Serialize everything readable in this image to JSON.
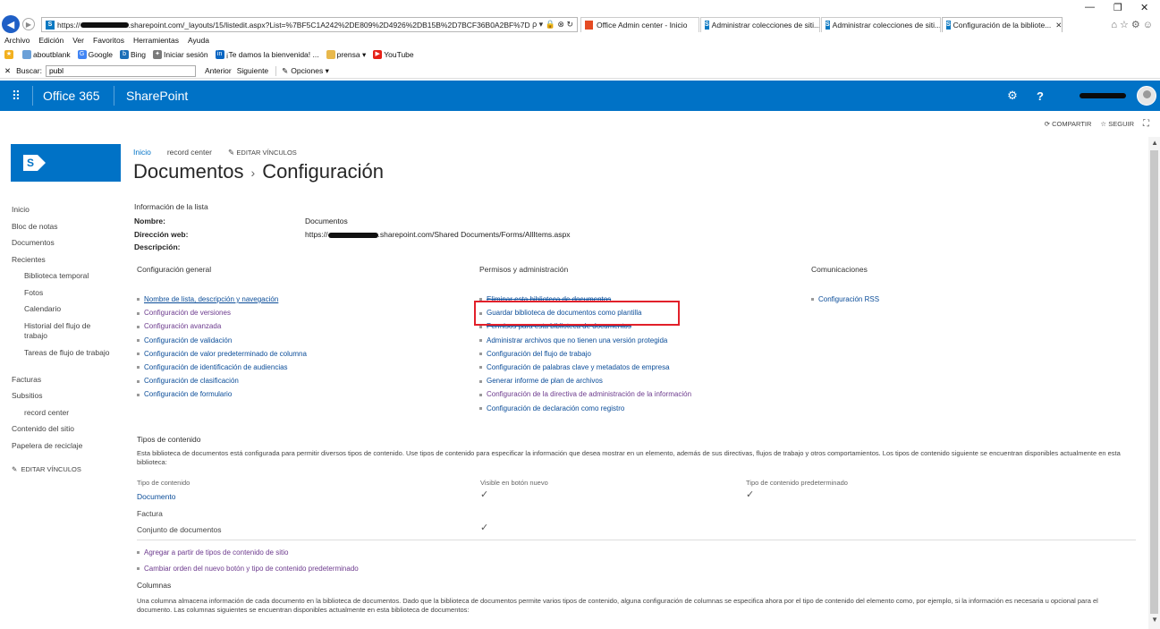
{
  "browser": {
    "url_prefix": "https://",
    "url_suffix": ".sharepoint.com/_layouts/15/listedit.aspx?List=%7BF5C1A242%2DE809%2D4926%2DB15B%2D7BCF36B0A2BF%7D",
    "url_icons": "ρ ▾ 🔒 ⊗ ↻",
    "tabs": [
      {
        "label": "Office Admin center - Inicio"
      },
      {
        "label": "Administrar colecciones de siti..."
      },
      {
        "label": "Administrar colecciones de siti..."
      },
      {
        "label": "Configuración de la bibliote..."
      }
    ],
    "menu": [
      "Archivo",
      "Edición",
      "Ver",
      "Favoritos",
      "Herramientas",
      "Ayuda"
    ],
    "favorites": [
      {
        "label": "aboutblank",
        "icon": "page-icon",
        "color": "#6aa0d8"
      },
      {
        "label": "Google",
        "icon": "google-icon",
        "color": "#4285f4"
      },
      {
        "label": "Bing",
        "icon": "bing-icon",
        "color": "#1b6fb8"
      },
      {
        "label": "Iniciar sesión",
        "icon": "msn-icon",
        "color": "#7a7a7a"
      },
      {
        "label": "¡Te damos la bienvenida! ...",
        "icon": "linkedin-icon",
        "color": "#0a66c2"
      },
      {
        "label": "prensa ▾",
        "icon": "folder-icon",
        "color": "#e8b84b"
      },
      {
        "label": "YouTube",
        "icon": "youtube-icon",
        "color": "#e62117"
      }
    ],
    "find": {
      "label": "Buscar:",
      "value": "publ",
      "previous": "Anterior",
      "next": "Siguiente",
      "options": "Opciones ▾"
    }
  },
  "suite": {
    "office": "Office 365",
    "app": "SharePoint",
    "share": "COMPARTIR",
    "follow": "SEGUIR"
  },
  "topnav": {
    "home": "Inicio",
    "record": "record center",
    "edit": "EDITAR VÍNCULOS"
  },
  "title": {
    "part1": "Documentos",
    "sep": "›",
    "part2": "Configuración"
  },
  "leftnav": [
    {
      "label": "Inicio",
      "sub": false
    },
    {
      "label": "Bloc de notas",
      "sub": false
    },
    {
      "label": "Documentos",
      "sub": false
    },
    {
      "label": "Recientes",
      "sub": false
    },
    {
      "label": "Biblioteca temporal",
      "sub": true
    },
    {
      "label": "Fotos",
      "sub": true
    },
    {
      "label": "Calendario",
      "sub": true
    },
    {
      "label": "Historial del flujo de trabajo",
      "sub": true
    },
    {
      "label": "Tareas de flujo de trabajo",
      "sub": true
    },
    {
      "label": "Facturas",
      "sub": false
    },
    {
      "label": "Subsitios",
      "sub": false
    },
    {
      "label": "record center",
      "sub": true
    },
    {
      "label": "Contenido del sitio",
      "sub": false
    },
    {
      "label": "Papelera de reciclaje",
      "sub": false
    }
  ],
  "leftnav_edit": "EDITAR VÍNCULOS",
  "info": {
    "heading": "Información de la lista",
    "name_label": "Nombre:",
    "name_value": "Documentos",
    "web_label": "Dirección web:",
    "web_prefix": "https://",
    "web_suffix": ".sharepoint.com/Shared Documents/Forms/AllItems.aspx",
    "desc_label": "Descripción:"
  },
  "general": {
    "heading": "Configuración general",
    "links": [
      "Nombre de lista, descripción y navegación",
      "Configuración de versiones",
      "Configuración avanzada",
      "Configuración de validación",
      "Configuración de valor predeterminado de columna",
      "Configuración de identificación de audiencias",
      "Configuración de clasificación",
      "Configuración de formulario"
    ]
  },
  "permissions": {
    "heading": "Permisos y administración",
    "links": [
      "Eliminar esta biblioteca de documentos",
      "Guardar biblioteca de documentos como plantilla",
      "Permisos para esta biblioteca de documentos",
      "Administrar archivos que no tienen una versión protegida",
      "Configuración del flujo de trabajo",
      "Configuración de palabras clave y metadatos de empresa",
      "Generar informe de plan de archivos",
      "Configuración de la directiva de administración de la información",
      "Configuración de declaración como registro"
    ]
  },
  "communications": {
    "heading": "Comunicaciones",
    "links": [
      "Configuración RSS"
    ]
  },
  "content_types": {
    "heading": "Tipos de contenido",
    "description": "Esta biblioteca de documentos está configurada para permitir diversos tipos de contenido. Use tipos de contenido para especificar la información que desea mostrar en un elemento, además de sus directivas, flujos de trabajo y otros comportamientos. Los tipos de contenido siguiente se encuentran disponibles actualmente en esta biblioteca:",
    "col1": "Tipo de contenido",
    "col2": "Visible en botón nuevo",
    "col3": "Tipo de contenido predeterminado",
    "rows": [
      {
        "name": "Documento",
        "visible": "✓",
        "default": "✓"
      },
      {
        "name": "Factura",
        "visible": "",
        "default": ""
      },
      {
        "name": "Conjunto de documentos",
        "visible": "✓",
        "default": ""
      }
    ],
    "add_link": "Agregar a partir de tipos de contenido de sitio",
    "order_link": "Cambiar orden del nuevo botón y tipo de contenido predeterminado"
  },
  "columns": {
    "heading": "Columnas",
    "description": "Una columna almacena información de cada documento en la biblioteca de documentos. Dado que la biblioteca de documentos permite varios tipos de contenido, alguna configuración de columnas se especifica ahora por el tipo de contenido del elemento como, por ejemplo, si la información es necesaria u opcional para el documento. Las columnas siguientes se encuentran disponibles actualmente en esta biblioteca de documentos:"
  },
  "colors": {
    "suite_blue": "#0072c6",
    "highlight_red": "#e2202a",
    "link_blue": "#0b4d99",
    "visited_purple": "#6d3b8e"
  }
}
